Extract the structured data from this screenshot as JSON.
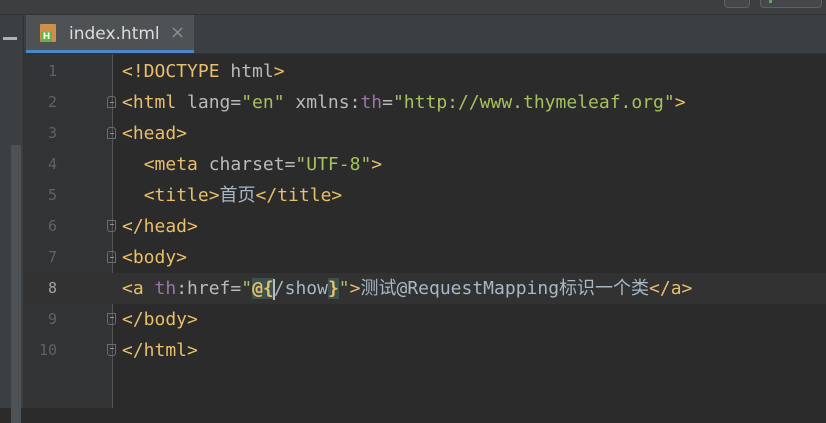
{
  "colors": {
    "editor_bg": "#2b2b2b",
    "tag": "#e8bf6a",
    "attribute": "#bababa",
    "namespace": "#9876aa",
    "string": "#a5c25c",
    "text": "#a9b7c6",
    "current_line": "#323232",
    "tab_underline": "#4a88c7"
  },
  "tab": {
    "icon": "html-file-icon",
    "label": "index.html",
    "close": "×"
  },
  "editor": {
    "current_line": 8,
    "lines": [
      {
        "n": "1",
        "fold": null,
        "tokens": [
          {
            "c": "t-doctype",
            "t": "<!DOCTYPE "
          },
          {
            "c": "t-attr",
            "t": "html"
          },
          {
            "c": "t-doctype",
            "t": ">"
          }
        ]
      },
      {
        "n": "2",
        "fold": "open",
        "tokens": [
          {
            "c": "t-tag",
            "t": "<html "
          },
          {
            "c": "t-attr",
            "t": "lang="
          },
          {
            "c": "t-val",
            "t": "\"en\" "
          },
          {
            "c": "t-attr",
            "t": "xmlns:"
          },
          {
            "c": "t-ns",
            "t": "th"
          },
          {
            "c": "t-attr",
            "t": "="
          },
          {
            "c": "t-val",
            "t": "\"http://www.thymeleaf.org\""
          },
          {
            "c": "t-tag",
            "t": ">"
          }
        ]
      },
      {
        "n": "3",
        "fold": "open",
        "tokens": [
          {
            "c": "t-tag",
            "t": "<head>"
          }
        ]
      },
      {
        "n": "4",
        "fold": null,
        "tokens": [
          {
            "c": "t-text",
            "t": "  "
          },
          {
            "c": "t-tag",
            "t": "<meta "
          },
          {
            "c": "t-attr",
            "t": "charset="
          },
          {
            "c": "t-val",
            "t": "\"UTF-8\""
          },
          {
            "c": "t-tag",
            "t": ">"
          }
        ]
      },
      {
        "n": "5",
        "fold": null,
        "tokens": [
          {
            "c": "t-text",
            "t": "  "
          },
          {
            "c": "t-tag",
            "t": "<title>"
          },
          {
            "c": "t-text cjk",
            "t": "首页"
          },
          {
            "c": "t-tag",
            "t": "</title>"
          }
        ]
      },
      {
        "n": "6",
        "fold": "close",
        "tokens": [
          {
            "c": "t-tag",
            "t": "</head>"
          }
        ]
      },
      {
        "n": "7",
        "fold": "open",
        "tokens": [
          {
            "c": "t-tag",
            "t": "<body>"
          }
        ]
      },
      {
        "n": "8",
        "fold": null,
        "tokens": [
          {
            "c": "t-tag",
            "t": "<a "
          },
          {
            "c": "t-ns",
            "t": "th"
          },
          {
            "c": "t-attr",
            "t": ":href="
          },
          {
            "c": "t-val",
            "t": "\""
          },
          {
            "c": "t-hl",
            "t": "@{"
          },
          {
            "c": "caret",
            "t": ""
          },
          {
            "c": "t-text",
            "t": "/show"
          },
          {
            "c": "t-hl",
            "t": "}"
          },
          {
            "c": "t-val",
            "t": "\""
          },
          {
            "c": "t-tag",
            "t": ">"
          },
          {
            "c": "t-text cjk",
            "t": "测试"
          },
          {
            "c": "t-text",
            "t": "@RequestMapping"
          },
          {
            "c": "t-text cjk",
            "t": "标识一个类"
          },
          {
            "c": "t-tag",
            "t": "</a>"
          }
        ]
      },
      {
        "n": "9",
        "fold": "close",
        "tokens": [
          {
            "c": "t-tag",
            "t": "</body>"
          }
        ]
      },
      {
        "n": "10",
        "fold": "close",
        "tokens": [
          {
            "c": "t-tag",
            "t": "</html>"
          }
        ]
      }
    ]
  }
}
